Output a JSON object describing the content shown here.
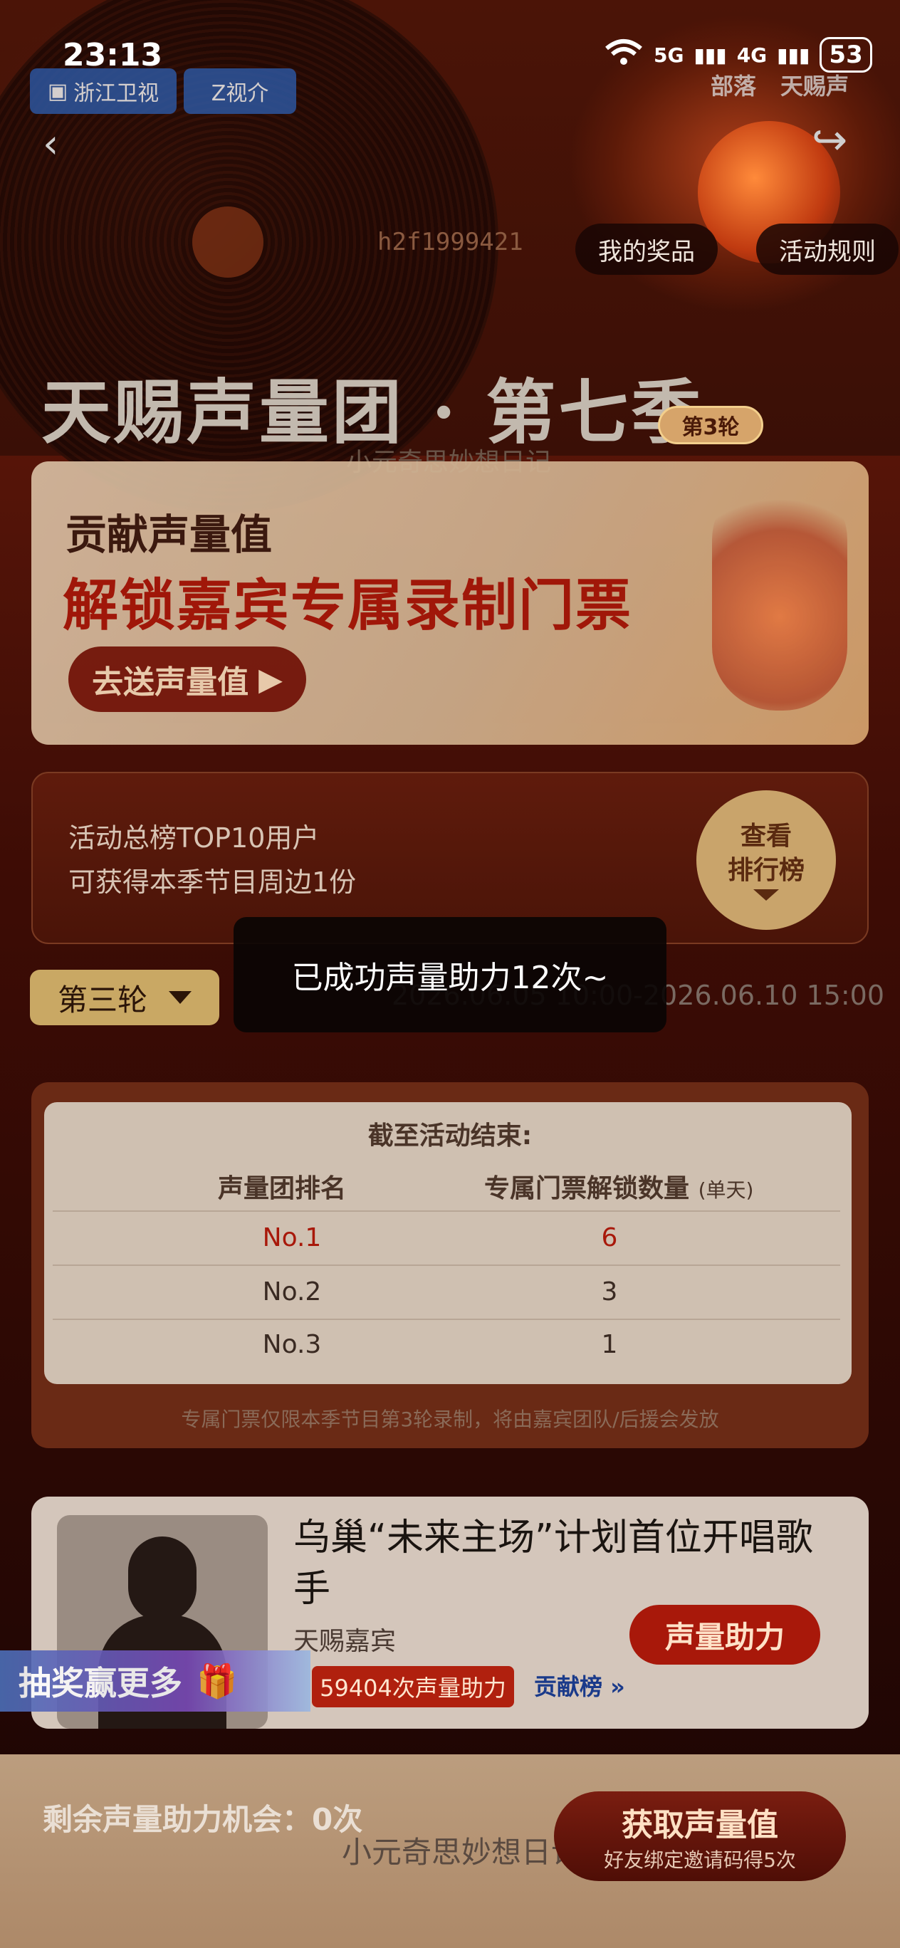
{
  "status_bar": {
    "time": "23:13",
    "signal_5g": "5G",
    "signal_4g": "4G",
    "battery": "53"
  },
  "header": {
    "logos": [
      "浙江卫视",
      "Z视介"
    ],
    "brand_right": [
      "部落",
      "天赐声"
    ],
    "buttons": {
      "my_prizes": "我的奖品",
      "rules": "活动规则"
    },
    "serial": "h2f1999421",
    "title": "天赐声量团 · 第七季",
    "round_badge": "第3轮",
    "subtitle": "小元奇思妙想日记"
  },
  "promo_card": {
    "line1": "贡献声量值",
    "line2": "解锁嘉宾专属录制门票",
    "button": "去送声量值"
  },
  "leader_card": {
    "line1": "活动总榜TOP10用户",
    "line2": "可获得本季节目周边1份",
    "button_line1": "查看",
    "button_line2": "排行榜"
  },
  "round_selector": {
    "selected": "第三轮",
    "time_range": "2026.06.05 10:00-2026.06.10 15:00"
  },
  "toast": "已成功声量助力12次~",
  "ticket_table": {
    "title": "截至活动结束:",
    "col_rank": "声量团排名",
    "col_count": "专属门票解锁数量",
    "col_unit": "(单天)",
    "rows": [
      {
        "rank": "No.1",
        "count": "6"
      },
      {
        "rank": "No.2",
        "count": "3"
      },
      {
        "rank": "No.3",
        "count": "1"
      }
    ],
    "note": "专属门票仅限本季节目第3轮录制，将由嘉宾团队/后援会发放"
  },
  "singer_card": {
    "name": "乌巢“未来主场”计划首位开唱歌手",
    "tag": "天赐嘉宾",
    "help_button": "声量助力",
    "help_count": "59404次声量助力",
    "contrib_link": "贡献榜 »"
  },
  "lottery_banner": "抽奖赢更多",
  "bottom_bar": {
    "remaining": "剩余声量助力机会：0次",
    "get_button_title": "获取声量值",
    "get_button_sub": "好友绑定邀请码得5次",
    "watermark": "小元奇思妙想日记"
  }
}
